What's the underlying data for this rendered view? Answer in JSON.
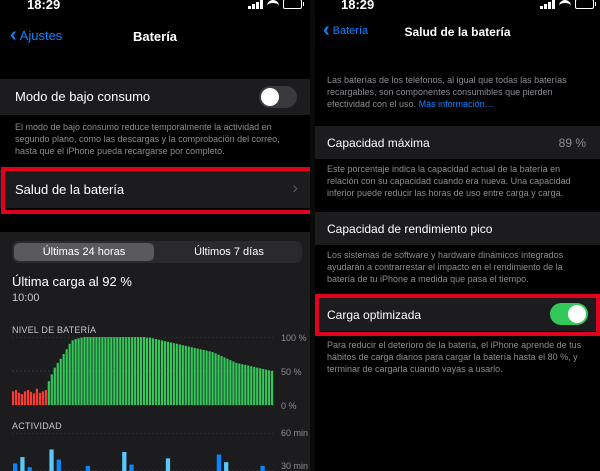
{
  "left": {
    "status": {
      "time": "18:29"
    },
    "nav": {
      "back": "Ajustes",
      "title": "Batería"
    },
    "low_power": {
      "label": "Modo de bajo consumo",
      "enabled": false,
      "footnote": "El modo de bajo consumo reduce temporalmente la actividad en segundo plano, como las descargas y la comprobación del correo, hasta que el iPhone pueda recargarse por completo."
    },
    "health_row": {
      "label": "Salud de la batería"
    },
    "tabs": [
      "Últimas 24 horas",
      "Últimos 7 días"
    ],
    "last_charge": {
      "title": "Última carga al 92 %",
      "time": "10:00"
    },
    "chart_battery": {
      "label": "NIVEL DE BATERÍA",
      "ticks": [
        "100 %",
        "50 %",
        "0 %"
      ]
    },
    "chart_activity": {
      "label": "ACTIVIDAD",
      "ticks": [
        "60 min",
        "30 min"
      ]
    }
  },
  "right": {
    "status": {
      "time": "18:29"
    },
    "nav": {
      "back": "Batería",
      "title": "Salud de la batería"
    },
    "intro": "Las baterías de los teléfonos, al igual que todas las baterías recargables, son componentes consumibles que pierden efectividad con el uso.",
    "intro_link": "Más información…",
    "max_capacity": {
      "label": "Capacidad máxima",
      "value": "89 %"
    },
    "max_capacity_note": "Este porcentaje indica la capacidad actual de la batería en relación con su capacidad cuando era nueva. Una capacidad inferior puede reducir las horas de uso entre carga y carga.",
    "peak": {
      "label": "Capacidad de rendimiento pico"
    },
    "peak_note": "Los sistemas de software y hardware dinámicos integrados ayudarán a contrarrestar el impacto en el rendimiento de la batería de tu iPhone a medida que pasa el tiempo.",
    "optimized": {
      "label": "Carga optimizada",
      "enabled": true
    },
    "optimized_note": "Para reducir el deterioro de la batería, el iPhone aprende de tus hábitos de carga diarios para cargar la batería hasta el 80 %, y terminar de cargarla cuando vayas a usarlo."
  },
  "colors": {
    "accent": "#0a84ff",
    "toggle_on": "#34c759",
    "highlight": "#e1001d",
    "battery_green": "#34c759",
    "battery_red": "#ff3b30",
    "activity_blue": "#0a84ff"
  },
  "chart_data": [
    {
      "type": "bar",
      "title": "NIVEL DE BATERÍA",
      "ylim": [
        0,
        100
      ],
      "values": [
        20,
        22,
        18,
        16,
        20,
        22,
        19,
        17,
        24,
        18,
        20,
        22,
        35,
        45,
        55,
        62,
        68,
        75,
        82,
        90,
        95,
        97,
        98,
        99,
        100,
        100,
        100,
        100,
        100,
        100,
        100,
        100,
        100,
        100,
        100,
        100,
        100,
        100,
        100,
        100,
        100,
        100,
        100,
        100,
        100,
        99,
        99,
        98,
        97,
        96,
        95,
        94,
        93,
        92,
        91,
        90,
        89,
        88,
        87,
        86,
        85,
        84,
        83,
        82,
        81,
        80,
        79,
        78,
        76,
        74,
        72,
        70,
        68,
        66,
        64,
        62,
        61,
        60,
        59,
        58,
        57,
        56,
        55,
        54,
        53,
        52,
        51,
        50
      ],
      "low_threshold": 25
    },
    {
      "type": "bar",
      "title": "ACTIVIDAD",
      "ylim": [
        0,
        60
      ],
      "values": [
        12,
        22,
        6,
        0,
        0,
        34,
        18,
        0,
        0,
        0,
        8,
        0,
        0,
        0,
        0,
        30,
        10,
        0,
        0,
        0,
        0,
        20,
        0,
        0,
        0,
        0,
        0,
        0,
        26,
        14,
        0,
        0,
        0,
        0,
        8,
        0
      ]
    }
  ]
}
